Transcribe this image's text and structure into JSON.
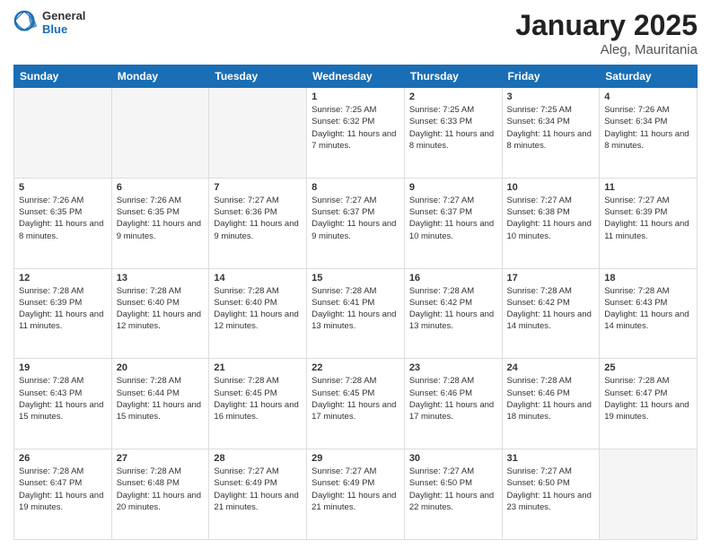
{
  "header": {
    "logo_general": "General",
    "logo_blue": "Blue",
    "main_title": "January 2025",
    "sub_title": "Aleg, Mauritania"
  },
  "days_of_week": [
    "Sunday",
    "Monday",
    "Tuesday",
    "Wednesday",
    "Thursday",
    "Friday",
    "Saturday"
  ],
  "weeks": [
    [
      {
        "day": "",
        "sunrise": "",
        "sunset": "",
        "daylight": ""
      },
      {
        "day": "",
        "sunrise": "",
        "sunset": "",
        "daylight": ""
      },
      {
        "day": "",
        "sunrise": "",
        "sunset": "",
        "daylight": ""
      },
      {
        "day": "1",
        "sunrise": "Sunrise: 7:25 AM",
        "sunset": "Sunset: 6:32 PM",
        "daylight": "Daylight: 11 hours and 7 minutes."
      },
      {
        "day": "2",
        "sunrise": "Sunrise: 7:25 AM",
        "sunset": "Sunset: 6:33 PM",
        "daylight": "Daylight: 11 hours and 8 minutes."
      },
      {
        "day": "3",
        "sunrise": "Sunrise: 7:25 AM",
        "sunset": "Sunset: 6:34 PM",
        "daylight": "Daylight: 11 hours and 8 minutes."
      },
      {
        "day": "4",
        "sunrise": "Sunrise: 7:26 AM",
        "sunset": "Sunset: 6:34 PM",
        "daylight": "Daylight: 11 hours and 8 minutes."
      }
    ],
    [
      {
        "day": "5",
        "sunrise": "Sunrise: 7:26 AM",
        "sunset": "Sunset: 6:35 PM",
        "daylight": "Daylight: 11 hours and 8 minutes."
      },
      {
        "day": "6",
        "sunrise": "Sunrise: 7:26 AM",
        "sunset": "Sunset: 6:35 PM",
        "daylight": "Daylight: 11 hours and 9 minutes."
      },
      {
        "day": "7",
        "sunrise": "Sunrise: 7:27 AM",
        "sunset": "Sunset: 6:36 PM",
        "daylight": "Daylight: 11 hours and 9 minutes."
      },
      {
        "day": "8",
        "sunrise": "Sunrise: 7:27 AM",
        "sunset": "Sunset: 6:37 PM",
        "daylight": "Daylight: 11 hours and 9 minutes."
      },
      {
        "day": "9",
        "sunrise": "Sunrise: 7:27 AM",
        "sunset": "Sunset: 6:37 PM",
        "daylight": "Daylight: 11 hours and 10 minutes."
      },
      {
        "day": "10",
        "sunrise": "Sunrise: 7:27 AM",
        "sunset": "Sunset: 6:38 PM",
        "daylight": "Daylight: 11 hours and 10 minutes."
      },
      {
        "day": "11",
        "sunrise": "Sunrise: 7:27 AM",
        "sunset": "Sunset: 6:39 PM",
        "daylight": "Daylight: 11 hours and 11 minutes."
      }
    ],
    [
      {
        "day": "12",
        "sunrise": "Sunrise: 7:28 AM",
        "sunset": "Sunset: 6:39 PM",
        "daylight": "Daylight: 11 hours and 11 minutes."
      },
      {
        "day": "13",
        "sunrise": "Sunrise: 7:28 AM",
        "sunset": "Sunset: 6:40 PM",
        "daylight": "Daylight: 11 hours and 12 minutes."
      },
      {
        "day": "14",
        "sunrise": "Sunrise: 7:28 AM",
        "sunset": "Sunset: 6:40 PM",
        "daylight": "Daylight: 11 hours and 12 minutes."
      },
      {
        "day": "15",
        "sunrise": "Sunrise: 7:28 AM",
        "sunset": "Sunset: 6:41 PM",
        "daylight": "Daylight: 11 hours and 13 minutes."
      },
      {
        "day": "16",
        "sunrise": "Sunrise: 7:28 AM",
        "sunset": "Sunset: 6:42 PM",
        "daylight": "Daylight: 11 hours and 13 minutes."
      },
      {
        "day": "17",
        "sunrise": "Sunrise: 7:28 AM",
        "sunset": "Sunset: 6:42 PM",
        "daylight": "Daylight: 11 hours and 14 minutes."
      },
      {
        "day": "18",
        "sunrise": "Sunrise: 7:28 AM",
        "sunset": "Sunset: 6:43 PM",
        "daylight": "Daylight: 11 hours and 14 minutes."
      }
    ],
    [
      {
        "day": "19",
        "sunrise": "Sunrise: 7:28 AM",
        "sunset": "Sunset: 6:43 PM",
        "daylight": "Daylight: 11 hours and 15 minutes."
      },
      {
        "day": "20",
        "sunrise": "Sunrise: 7:28 AM",
        "sunset": "Sunset: 6:44 PM",
        "daylight": "Daylight: 11 hours and 15 minutes."
      },
      {
        "day": "21",
        "sunrise": "Sunrise: 7:28 AM",
        "sunset": "Sunset: 6:45 PM",
        "daylight": "Daylight: 11 hours and 16 minutes."
      },
      {
        "day": "22",
        "sunrise": "Sunrise: 7:28 AM",
        "sunset": "Sunset: 6:45 PM",
        "daylight": "Daylight: 11 hours and 17 minutes."
      },
      {
        "day": "23",
        "sunrise": "Sunrise: 7:28 AM",
        "sunset": "Sunset: 6:46 PM",
        "daylight": "Daylight: 11 hours and 17 minutes."
      },
      {
        "day": "24",
        "sunrise": "Sunrise: 7:28 AM",
        "sunset": "Sunset: 6:46 PM",
        "daylight": "Daylight: 11 hours and 18 minutes."
      },
      {
        "day": "25",
        "sunrise": "Sunrise: 7:28 AM",
        "sunset": "Sunset: 6:47 PM",
        "daylight": "Daylight: 11 hours and 19 minutes."
      }
    ],
    [
      {
        "day": "26",
        "sunrise": "Sunrise: 7:28 AM",
        "sunset": "Sunset: 6:47 PM",
        "daylight": "Daylight: 11 hours and 19 minutes."
      },
      {
        "day": "27",
        "sunrise": "Sunrise: 7:28 AM",
        "sunset": "Sunset: 6:48 PM",
        "daylight": "Daylight: 11 hours and 20 minutes."
      },
      {
        "day": "28",
        "sunrise": "Sunrise: 7:27 AM",
        "sunset": "Sunset: 6:49 PM",
        "daylight": "Daylight: 11 hours and 21 minutes."
      },
      {
        "day": "29",
        "sunrise": "Sunrise: 7:27 AM",
        "sunset": "Sunset: 6:49 PM",
        "daylight": "Daylight: 11 hours and 21 minutes."
      },
      {
        "day": "30",
        "sunrise": "Sunrise: 7:27 AM",
        "sunset": "Sunset: 6:50 PM",
        "daylight": "Daylight: 11 hours and 22 minutes."
      },
      {
        "day": "31",
        "sunrise": "Sunrise: 7:27 AM",
        "sunset": "Sunset: 6:50 PM",
        "daylight": "Daylight: 11 hours and 23 minutes."
      },
      {
        "day": "",
        "sunrise": "",
        "sunset": "",
        "daylight": ""
      }
    ]
  ]
}
